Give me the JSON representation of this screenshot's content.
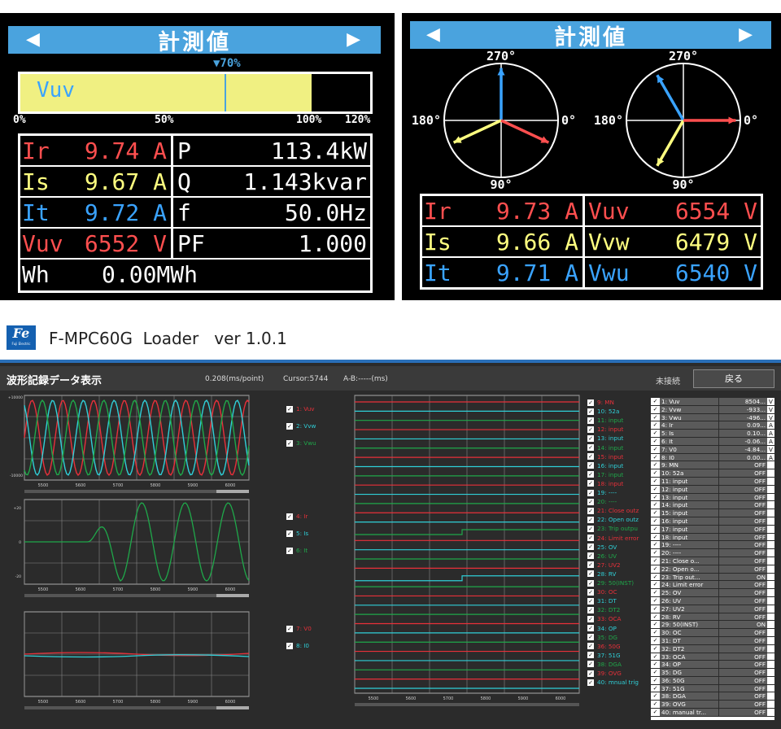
{
  "panel1": {
    "title": "計測値",
    "marker_label": "▼70%",
    "bar_label": "Vuv",
    "bar_fill_percent": 100,
    "marker_percent": 70,
    "bar_max_percent": 120,
    "scale": [
      "0%",
      "50%",
      "100%",
      "120%"
    ],
    "rows": [
      {
        "name": "Ir",
        "value": "9.74 A",
        "color": "#ff4f4f",
        "right_name": "P",
        "right_value": "113.4kW"
      },
      {
        "name": "Is",
        "value": "9.67 A",
        "color": "#ffff80",
        "right_name": "Q",
        "right_value": "1.143kvar"
      },
      {
        "name": "It",
        "value": "9.72 A",
        "color": "#3aa3ff",
        "right_name": "f",
        "right_value": "50.0Hz"
      },
      {
        "name": "Vuv",
        "value": "6552 V",
        "color": "#ff4f4f",
        "right_name": "PF",
        "right_value": "1.000"
      }
    ],
    "wh": {
      "name": "Wh",
      "value": "0.00MWh"
    }
  },
  "panel2": {
    "title": "計測値",
    "deg_top": "270°",
    "deg_bottom": "90°",
    "deg_left": "180°",
    "deg_right": "0°",
    "phasor_left_angles": [
      270,
      155,
      25
    ],
    "phasor_right_angles": [
      240,
      120,
      0
    ],
    "rows": [
      {
        "name": "Ir",
        "value": "9.73 A",
        "color": "#ff4f4f",
        "right_name": "Vuv",
        "right_value": "6554 V",
        "right_color": "#ff4f4f"
      },
      {
        "name": "Is",
        "value": "9.66 A",
        "color": "#ffff80",
        "right_name": "Vvw",
        "right_value": "6479 V",
        "right_color": "#ffff80"
      },
      {
        "name": "It",
        "value": "9.71 A",
        "color": "#3aa3ff",
        "right_name": "Vwu",
        "right_value": "6540 V",
        "right_color": "#3aa3ff"
      }
    ]
  },
  "app": {
    "title": "F-MPC60G  Loader   ver 1.0.1",
    "logo_text": "Fe",
    "logo_sub": "Fuji Electric",
    "header": "波形記録データ表示",
    "interval": "0.208(ms/point)",
    "cursor": "Cursor:5744",
    "ab": "A-B:-----(ms)",
    "status": "未接続",
    "back_button": "戻る",
    "colors": {
      "red": "#e8303a",
      "cyan": "#2fd0d8",
      "green": "#1fa84a",
      "bg": "#2b2b2b"
    },
    "x_ticks": [
      "5500",
      "5600",
      "5700",
      "5800",
      "5900",
      "6000"
    ],
    "chart1": {
      "ymax": "+10000",
      "ymin": "-10000",
      "series": [
        "1: Vuv",
        "2: Vvw",
        "3: Vwu"
      ],
      "series_colors": [
        "#e8303a",
        "#2fd0d8",
        "#1fa84a"
      ]
    },
    "chart2": {
      "ymax": "+20",
      "ymin": "-20",
      "yzero": "0",
      "series": [
        "4: Ir",
        "5: Is",
        "6: It"
      ],
      "series_colors": [
        "#e8303a",
        "#2fd0d8",
        "#1fa84a"
      ]
    },
    "chart3": {
      "series": [
        "7: V0",
        "8: I0"
      ],
      "series_colors": [
        "#e8303a",
        "#2fd0d8"
      ]
    },
    "digital_channels": [
      {
        "label": "9: MN",
        "color": "#e8303a"
      },
      {
        "label": "10: 52a",
        "color": "#2fd0d8"
      },
      {
        "label": "11: input",
        "color": "#1fa84a"
      },
      {
        "label": "12: input",
        "color": "#e8303a"
      },
      {
        "label": "13: input",
        "color": "#2fd0d8"
      },
      {
        "label": "14: input",
        "color": "#1fa84a"
      },
      {
        "label": "15: input",
        "color": "#e8303a"
      },
      {
        "label": "16: input",
        "color": "#2fd0d8"
      },
      {
        "label": "17: input",
        "color": "#1fa84a"
      },
      {
        "label": "18: input",
        "color": "#e8303a"
      },
      {
        "label": "19: ----",
        "color": "#2fd0d8"
      },
      {
        "label": "20: ----",
        "color": "#1fa84a"
      },
      {
        "label": "21: Close outz",
        "color": "#e8303a"
      },
      {
        "label": "22: Open outz",
        "color": "#2fd0d8"
      },
      {
        "label": "23: Trip outpu",
        "color": "#1fa84a"
      },
      {
        "label": "24: Limit error",
        "color": "#e8303a"
      },
      {
        "label": "25: OV",
        "color": "#2fd0d8"
      },
      {
        "label": "26: UV",
        "color": "#1fa84a"
      },
      {
        "label": "27: UV2",
        "color": "#e8303a"
      },
      {
        "label": "28: RV",
        "color": "#2fd0d8"
      },
      {
        "label": "29: 50(INST)",
        "color": "#1fa84a"
      },
      {
        "label": "30: OC",
        "color": "#e8303a"
      },
      {
        "label": "31: DT",
        "color": "#2fd0d8"
      },
      {
        "label": "32: DT2",
        "color": "#1fa84a"
      },
      {
        "label": "33: OCA",
        "color": "#e8303a"
      },
      {
        "label": "34: OP",
        "color": "#2fd0d8"
      },
      {
        "label": "35: DG",
        "color": "#1fa84a"
      },
      {
        "label": "36: 50G",
        "color": "#e8303a"
      },
      {
        "label": "37: 51G",
        "color": "#2fd0d8"
      },
      {
        "label": "38: DGA",
        "color": "#1fa84a"
      },
      {
        "label": "39: OVG",
        "color": "#e8303a"
      },
      {
        "label": "40: mnual trig",
        "color": "#2fd0d8"
      }
    ],
    "table": [
      {
        "name": "1: Vuv",
        "value": "8504...",
        "unit": "V"
      },
      {
        "name": "2: Vvw",
        "value": "-933...",
        "unit": "V"
      },
      {
        "name": "3: Vwu",
        "value": "-496...",
        "unit": "V"
      },
      {
        "name": "4: Ir",
        "value": "0.09...",
        "unit": "A"
      },
      {
        "name": "5: Is",
        "value": "0.10...",
        "unit": "A"
      },
      {
        "name": "6: It",
        "value": "-0.06...",
        "unit": "A"
      },
      {
        "name": "7: V0",
        "value": "-4.84...",
        "unit": "V"
      },
      {
        "name": "8: I0",
        "value": "0.00...",
        "unit": "A"
      },
      {
        "name": "9: MN",
        "value": "OFF",
        "unit": ""
      },
      {
        "name": "10: 52a",
        "value": "OFF",
        "unit": ""
      },
      {
        "name": "11: input",
        "value": "OFF",
        "unit": ""
      },
      {
        "name": "12: input",
        "value": "OFF",
        "unit": ""
      },
      {
        "name": "13: input",
        "value": "OFF",
        "unit": ""
      },
      {
        "name": "14: input",
        "value": "OFF",
        "unit": ""
      },
      {
        "name": "15: input",
        "value": "OFF",
        "unit": ""
      },
      {
        "name": "16: input",
        "value": "OFF",
        "unit": ""
      },
      {
        "name": "17: input",
        "value": "OFF",
        "unit": ""
      },
      {
        "name": "18: input",
        "value": "OFF",
        "unit": ""
      },
      {
        "name": "19: ----",
        "value": "OFF",
        "unit": ""
      },
      {
        "name": "20: ----",
        "value": "OFF",
        "unit": ""
      },
      {
        "name": "21: Close o...",
        "value": "OFF",
        "unit": ""
      },
      {
        "name": "22: Open o...",
        "value": "OFF",
        "unit": ""
      },
      {
        "name": "23: Trip out...",
        "value": "ON",
        "unit": ""
      },
      {
        "name": "24: Limit error",
        "value": "OFF",
        "unit": ""
      },
      {
        "name": "25: OV",
        "value": "OFF",
        "unit": ""
      },
      {
        "name": "26: UV",
        "value": "OFF",
        "unit": ""
      },
      {
        "name": "27: UV2",
        "value": "OFF",
        "unit": ""
      },
      {
        "name": "28: RV",
        "value": "OFF",
        "unit": ""
      },
      {
        "name": "29: 50(INST)",
        "value": "ON",
        "unit": ""
      },
      {
        "name": "30: OC",
        "value": "OFF",
        "unit": ""
      },
      {
        "name": "31: DT",
        "value": "OFF",
        "unit": ""
      },
      {
        "name": "32: DT2",
        "value": "OFF",
        "unit": ""
      },
      {
        "name": "33: OCA",
        "value": "OFF",
        "unit": ""
      },
      {
        "name": "34: OP",
        "value": "OFF",
        "unit": ""
      },
      {
        "name": "35: DG",
        "value": "OFF",
        "unit": ""
      },
      {
        "name": "36: 50G",
        "value": "OFF",
        "unit": ""
      },
      {
        "name": "37: 51G",
        "value": "OFF",
        "unit": ""
      },
      {
        "name": "38: DGA",
        "value": "OFF",
        "unit": ""
      },
      {
        "name": "39: OVG",
        "value": "OFF",
        "unit": ""
      },
      {
        "name": "40: manual tr...",
        "value": "OFF",
        "unit": ""
      }
    ]
  }
}
